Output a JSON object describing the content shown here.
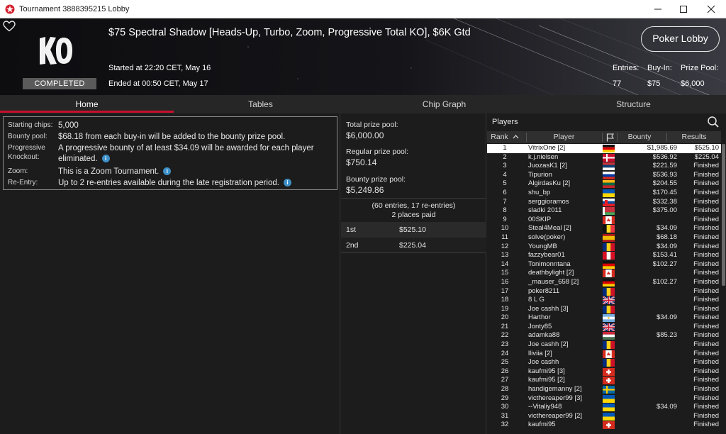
{
  "window": {
    "title": "Tournament 3888395215 Lobby",
    "controls": [
      "minimize",
      "maximize",
      "close"
    ]
  },
  "header": {
    "logo_text": "KO",
    "status_badge": "COMPLETED",
    "title": "$75 Spectral Shadow [Heads-Up, Turbo, Zoom, Progressive Total KO], $6K Gtd",
    "started": "Started at 22:20 CET, May 16",
    "ended": "Ended at 00:50 CET, May 17",
    "lobby_button": "Poker Lobby",
    "stats": {
      "entries_label": "Entries:",
      "entries_value": "77",
      "buyin_label": "Buy-In:",
      "buyin_value": "$75",
      "prizepool_label": "Prize Pool:",
      "prizepool_value": "$6,000"
    }
  },
  "tabs": [
    {
      "label": "Home",
      "active": true
    },
    {
      "label": "Tables",
      "active": false
    },
    {
      "label": "Chip Graph",
      "active": false
    },
    {
      "label": "Structure",
      "active": false
    }
  ],
  "info": {
    "starting_chips_label": "Starting chips:",
    "starting_chips_value": "5,000",
    "bounty_pool_label": "Bounty pool:",
    "bounty_pool_value": "$68.18 from each buy-in will be added to the bounty prize pool.",
    "progressive_label_1": "Progressive",
    "progressive_label_2": "Knockout:",
    "progressive_value": "A progressive bounty of at least $34.09 will be awarded for each player eliminated.",
    "zoom_label": "Zoom:",
    "zoom_value": "This is a Zoom Tournament.",
    "reentry_label": "Re-Entry:",
    "reentry_value": "Up to 2 re-entries available during the late registration period."
  },
  "prize": {
    "total_label": "Total prize pool:",
    "total_value": "$6,000.00",
    "regular_label": "Regular prize pool:",
    "regular_value": "$750.14",
    "bounty_label": "Bounty prize pool:",
    "bounty_value": "$5,249.86",
    "entries_line": "(60 entries, 17 re-entries)",
    "places_line": "2 places paid",
    "payouts": [
      {
        "place": "1st",
        "amount": "$525.10"
      },
      {
        "place": "2nd",
        "amount": "$225.04"
      }
    ]
  },
  "players": {
    "title": "Players",
    "columns": {
      "rank": "Rank",
      "player": "Player",
      "bounty": "Bounty",
      "results": "Results"
    },
    "rows": [
      {
        "rank": "1",
        "name": "VitrixOne [2]",
        "flag": "germany",
        "bounty": "$1,985.69",
        "result": "$525.10"
      },
      {
        "rank": "2",
        "name": "k.j.nielsen",
        "flag": "denmark",
        "bounty": "$536.92",
        "result": "$225.04"
      },
      {
        "rank": "3",
        "name": "JuozasK1 [2]",
        "flag": "serbia",
        "bounty": "$221.59",
        "result": "Finished"
      },
      {
        "rank": "4",
        "name": "Tipurion",
        "flag": "russia",
        "bounty": "$536.93",
        "result": "Finished"
      },
      {
        "rank": "5",
        "name": "AlgirdasKu [2]",
        "flag": "lithuania",
        "bounty": "$204.55",
        "result": "Finished"
      },
      {
        "rank": "6",
        "name": "shu_bp",
        "flag": "ukraine",
        "bounty": "$170.45",
        "result": "Finished"
      },
      {
        "rank": "7",
        "name": "serggioramos",
        "flag": "slovakia",
        "bounty": "$332.38",
        "result": "Finished"
      },
      {
        "rank": "8",
        "name": "sladki 2011",
        "flag": "belarus",
        "bounty": "$375.00",
        "result": "Finished"
      },
      {
        "rank": "9",
        "name": "00SKIP",
        "flag": "canada",
        "bounty": "",
        "result": "Finished"
      },
      {
        "rank": "10",
        "name": "Steal4Meal [2]",
        "flag": "belgium",
        "bounty": "$34.09",
        "result": "Finished"
      },
      {
        "rank": "11",
        "name": "solve(poker)",
        "flag": "spain",
        "bounty": "$68.18",
        "result": "Finished"
      },
      {
        "rank": "12",
        "name": "YoungMB",
        "flag": "romania",
        "bounty": "$34.09",
        "result": "Finished"
      },
      {
        "rank": "13",
        "name": "fazzybear01",
        "flag": "peru",
        "bounty": "$153.41",
        "result": "Finished"
      },
      {
        "rank": "14",
        "name": "Tonimonntana",
        "flag": "germany",
        "bounty": "$102.27",
        "result": "Finished"
      },
      {
        "rank": "15",
        "name": "deathbylight [2]",
        "flag": "canada",
        "bounty": "",
        "result": "Finished"
      },
      {
        "rank": "16",
        "name": "_mauser_658 [2]",
        "flag": "germany",
        "bounty": "$102.27",
        "result": "Finished"
      },
      {
        "rank": "17",
        "name": "poker8211",
        "flag": "romania",
        "bounty": "",
        "result": "Finished"
      },
      {
        "rank": "18",
        "name": "8 L G",
        "flag": "uk",
        "bounty": "",
        "result": "Finished"
      },
      {
        "rank": "19",
        "name": "Joe cashh [3]",
        "flag": "romania",
        "bounty": "",
        "result": "Finished"
      },
      {
        "rank": "20",
        "name": "Harthor",
        "flag": "argentina",
        "bounty": "$34.09",
        "result": "Finished"
      },
      {
        "rank": "21",
        "name": "Jonty85",
        "flag": "uk",
        "bounty": "",
        "result": "Finished"
      },
      {
        "rank": "22",
        "name": "adamka88",
        "flag": "hungary",
        "bounty": "$85.23",
        "result": "Finished"
      },
      {
        "rank": "23",
        "name": "Joe cashh [2]",
        "flag": "romania",
        "bounty": "",
        "result": "Finished"
      },
      {
        "rank": "24",
        "name": "lliviia [2]",
        "flag": "canada",
        "bounty": "",
        "result": "Finished"
      },
      {
        "rank": "25",
        "name": "Joe cashh",
        "flag": "romania",
        "bounty": "",
        "result": "Finished"
      },
      {
        "rank": "26",
        "name": "kaufmi95 [3]",
        "flag": "switzerland",
        "bounty": "",
        "result": "Finished"
      },
      {
        "rank": "27",
        "name": "kaufmi95 [2]",
        "flag": "switzerland",
        "bounty": "",
        "result": "Finished"
      },
      {
        "rank": "28",
        "name": "handigemanny [2]",
        "flag": "sweden",
        "bounty": "",
        "result": "Finished"
      },
      {
        "rank": "29",
        "name": "victhereaper99 [3]",
        "flag": "ukraine",
        "bounty": "",
        "result": "Finished"
      },
      {
        "rank": "30",
        "name": "--Vitaliy948",
        "flag": "ukraine",
        "bounty": "$34.09",
        "result": "Finished"
      },
      {
        "rank": "31",
        "name": "victhereaper99 [2]",
        "flag": "ukraine",
        "bounty": "",
        "result": "Finished"
      },
      {
        "rank": "32",
        "name": "kaufmi95",
        "flag": "switzerland",
        "bounty": "",
        "result": "Finished"
      }
    ]
  },
  "colors": {
    "accent_red": "#c8102e",
    "background": "#1c1c1c",
    "header_bg": "#0e0e11",
    "info_icon": "#3d8fc7"
  }
}
